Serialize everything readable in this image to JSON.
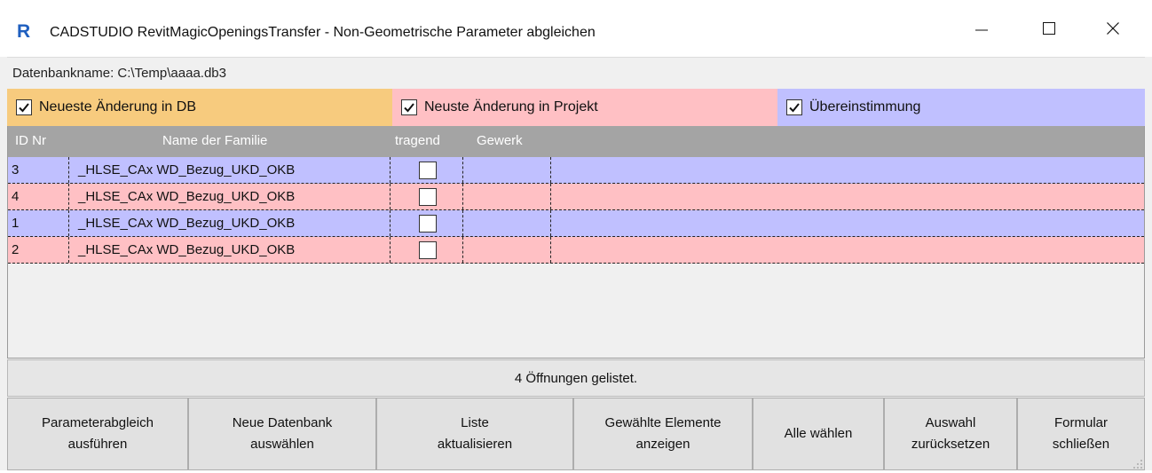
{
  "window": {
    "title": "CADSTUDIO RevitMagicOpeningsTransfer - Non-Geometrische Parameter abgleichen",
    "app_icon": "revit-r-icon",
    "controls": [
      "minimize-icon",
      "maximize-icon",
      "close-icon"
    ]
  },
  "database": {
    "label": "Datenbankname: C:\\Temp\\aaaa.db3"
  },
  "legend": {
    "items": [
      {
        "label": "Neueste Änderung in DB",
        "checked": true,
        "color": "#f7cb7e"
      },
      {
        "label": "Neuste Änderung in Projekt",
        "checked": true,
        "color": "#ffc0c4"
      },
      {
        "label": "Übereinstimmung",
        "checked": true,
        "color": "#c0c0ff"
      }
    ]
  },
  "grid": {
    "columns": [
      "ID Nr",
      "Name der Familie",
      "tragend",
      "Gewerk"
    ],
    "header_color": "#a4a4a4",
    "rows": [
      {
        "id": "3",
        "name": "_HLSE_CAx WD_Bezug_UKD_OKB",
        "tragend": false,
        "gewerk": "",
        "color": "#c0c0ff"
      },
      {
        "id": "4",
        "name": "_HLSE_CAx WD_Bezug_UKD_OKB",
        "tragend": false,
        "gewerk": "",
        "color": "#ffc0c4"
      },
      {
        "id": "1",
        "name": "_HLSE_CAx WD_Bezug_UKD_OKB",
        "tragend": false,
        "gewerk": "",
        "color": "#c0c0ff"
      },
      {
        "id": "2",
        "name": "_HLSE_CAx WD_Bezug_UKD_OKB",
        "tragend": false,
        "gewerk": "",
        "color": "#ffc0c4"
      }
    ]
  },
  "status": {
    "text": "4 Öffnungen gelistet."
  },
  "buttons": [
    {
      "label": "Parameterabgleich\nausführen"
    },
    {
      "label": "Neue Datenbank\nauswählen"
    },
    {
      "label": "Liste\naktualisieren"
    },
    {
      "label": "Gewählte Elemente\nanzeigen"
    },
    {
      "label": "Alle wählen"
    },
    {
      "label": "Auswahl\nzurücksetzen"
    },
    {
      "label": "Formular\nschließen"
    }
  ]
}
